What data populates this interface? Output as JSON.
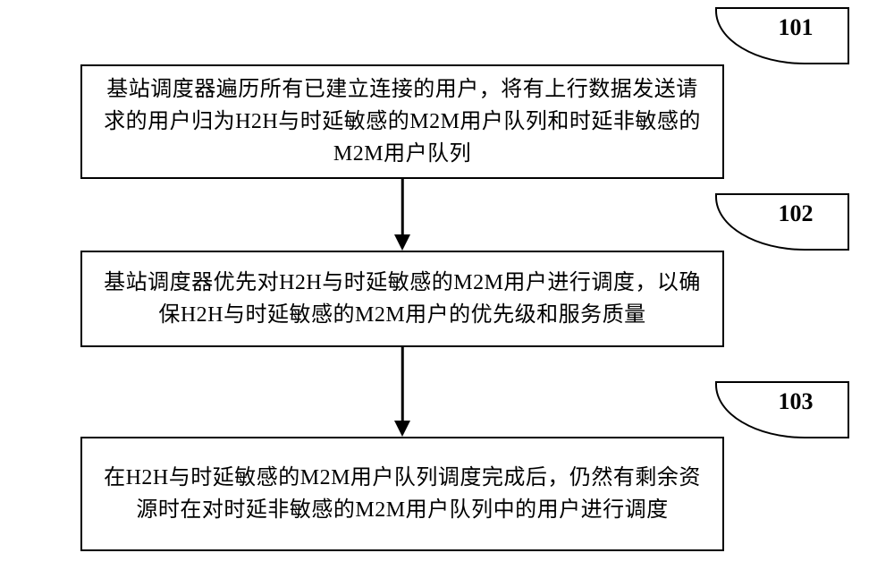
{
  "chart_data": {
    "type": "flowchart",
    "direction": "top-to-bottom",
    "nodes": [
      {
        "id": "101",
        "label": "101",
        "text": "基站调度器遍历所有已建立连接的用户，将有上行数据发送请求的用户归为H2H与时延敏感的M2M用户队列和时延非敏感的M2M用户队列"
      },
      {
        "id": "102",
        "label": "102",
        "text": "基站调度器优先对H2H与时延敏感的M2M用户进行调度，以确保H2H与时延敏感的M2M用户的优先级和服务质量"
      },
      {
        "id": "103",
        "label": "103",
        "text": "在H2H与时延敏感的M2M用户队列调度完成后，仍然有剩余资源时在对时延非敏感的M2M用户队列中的用户进行调度"
      }
    ],
    "edges": [
      {
        "from": "101",
        "to": "102"
      },
      {
        "from": "102",
        "to": "103"
      }
    ]
  },
  "steps": {
    "s1": {
      "label": "101",
      "text": "基站调度器遍历所有已建立连接的用户，将有上行数据发送请求的用户归为H2H与时延敏感的M2M用户队列和时延非敏感的M2M用户队列"
    },
    "s2": {
      "label": "102",
      "text": "基站调度器优先对H2H与时延敏感的M2M用户进行调度，以确保H2H与时延敏感的M2M用户的优先级和服务质量"
    },
    "s3": {
      "label": "103",
      "text": "在H2H与时延敏感的M2M用户队列调度完成后，仍然有剩余资源时在对时延非敏感的M2M用户队列中的用户进行调度"
    }
  }
}
